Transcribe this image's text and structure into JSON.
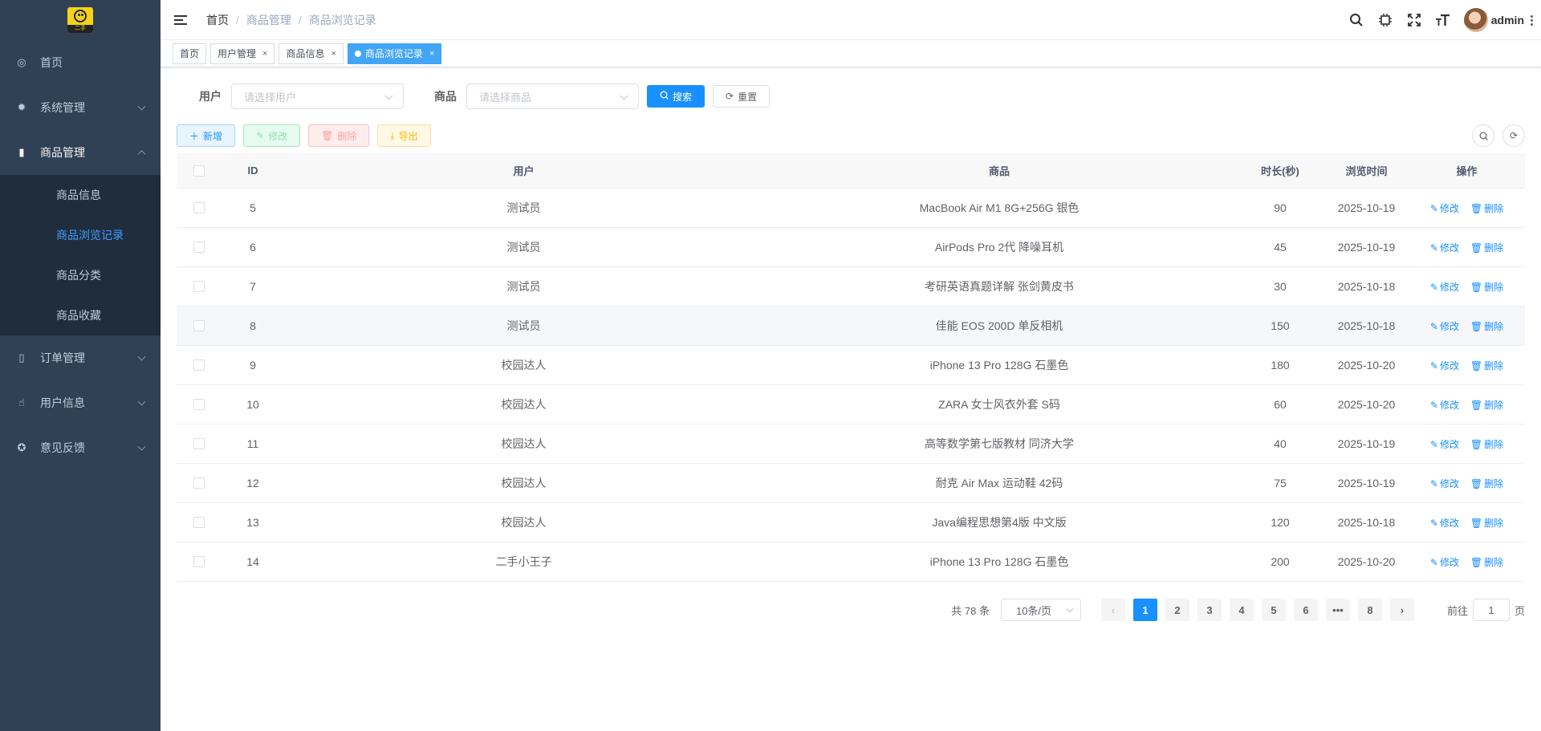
{
  "logo": {
    "text": "二手"
  },
  "sidebar": {
    "items": [
      {
        "label": "首页",
        "icon": "dashboard-icon",
        "glyph": "◎"
      },
      {
        "label": "系统管理",
        "icon": "gear-icon",
        "glyph": "✹"
      },
      {
        "label": "商品管理",
        "icon": "documents-icon",
        "glyph": "▮"
      },
      {
        "label": "订单管理",
        "icon": "book-icon",
        "glyph": "▯"
      },
      {
        "label": "用户信息",
        "icon": "user-icon",
        "glyph": "☝"
      },
      {
        "label": "意见反馈",
        "icon": "lifebuoy-icon",
        "glyph": "✪"
      }
    ],
    "submenu": [
      "商品信息",
      "商品浏览记录",
      "商品分类",
      "商品收藏"
    ]
  },
  "header": {
    "breadcrumb": [
      "首页",
      "商品管理",
      "商品浏览记录"
    ],
    "username": "admin"
  },
  "tags": [
    {
      "label": "首页"
    },
    {
      "label": "用户管理",
      "close": "×"
    },
    {
      "label": "商品信息",
      "close": "×"
    },
    {
      "label": "商品浏览记录",
      "close": "×"
    }
  ],
  "search": {
    "user_label": "用户",
    "user_placeholder": "请选择用户",
    "product_label": "商品",
    "product_placeholder": "请选择商品",
    "search_btn": "搜索",
    "reset_btn": "重置"
  },
  "toolbar": {
    "add": "新增",
    "edit": "修改",
    "delete": "删除",
    "export": "导出"
  },
  "table": {
    "headers": {
      "id": "ID",
      "user": "用户",
      "product": "商品",
      "duration": "时长(秒)",
      "time": "浏览时间",
      "ops": "操作"
    },
    "edit_label": "修改",
    "delete_label": "删除",
    "rows": [
      {
        "id": "5",
        "user": "测试员",
        "product": "MacBook Air M1 8G+256G 银色",
        "duration": "90",
        "time": "2025-10-19"
      },
      {
        "id": "6",
        "user": "测试员",
        "product": "AirPods Pro 2代 降噪耳机",
        "duration": "45",
        "time": "2025-10-19"
      },
      {
        "id": "7",
        "user": "测试员",
        "product": "考研英语真题详解 张剑黄皮书",
        "duration": "30",
        "time": "2025-10-18"
      },
      {
        "id": "8",
        "user": "测试员",
        "product": "佳能 EOS 200D 单反相机",
        "duration": "150",
        "time": "2025-10-18"
      },
      {
        "id": "9",
        "user": "校园达人",
        "product": "iPhone 13 Pro 128G 石墨色",
        "duration": "180",
        "time": "2025-10-20"
      },
      {
        "id": "10",
        "user": "校园达人",
        "product": "ZARA 女士风衣外套 S码",
        "duration": "60",
        "time": "2025-10-20"
      },
      {
        "id": "11",
        "user": "校园达人",
        "product": "高等数学第七版教材 同济大学",
        "duration": "40",
        "time": "2025-10-19"
      },
      {
        "id": "12",
        "user": "校园达人",
        "product": "耐克 Air Max 运动鞋 42码",
        "duration": "75",
        "time": "2025-10-19"
      },
      {
        "id": "13",
        "user": "校园达人",
        "product": "Java编程思想第4版 中文版",
        "duration": "120",
        "time": "2025-10-18"
      },
      {
        "id": "14",
        "user": "二手小王子",
        "product": "iPhone 13 Pro 128G 石墨色",
        "duration": "200",
        "time": "2025-10-20"
      }
    ]
  },
  "pagination": {
    "total": "共 78 条",
    "page_size": "10条/页",
    "pages": [
      "1",
      "2",
      "3",
      "4",
      "5",
      "6",
      "•••",
      "8"
    ],
    "current": "1",
    "jump_prefix": "前往",
    "jump_value": "1",
    "jump_suffix": "页"
  },
  "colors": {
    "sidebar_bg": "#304156",
    "submenu_bg": "#1f2d3d",
    "primary": "#1890ff",
    "active_tag": "#42a5f5"
  }
}
